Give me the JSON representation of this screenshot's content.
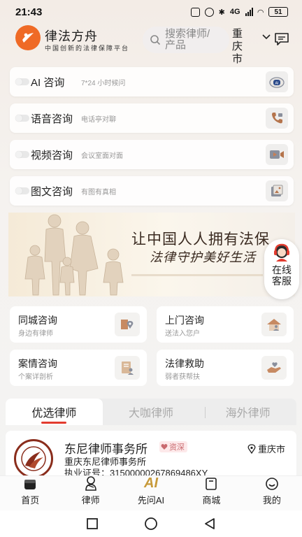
{
  "status_bar": {
    "time": "21:43",
    "network": "4G",
    "battery": "51"
  },
  "header": {
    "app_name": "律法方舟",
    "slogan": "中国创新的法律保障平台",
    "search_placeholder": "搜索律师/产品",
    "city": "重庆市"
  },
  "consult_items": [
    {
      "title": "AI 咨询",
      "subtitle": "7*24 小时候问",
      "icon": "ai-headset-icon"
    },
    {
      "title": "语音咨询",
      "subtitle": "电话亭对聊",
      "icon": "phone-icon"
    },
    {
      "title": "视频咨询",
      "subtitle": "会议室面对面",
      "icon": "video-icon"
    },
    {
      "title": "图文咨询",
      "subtitle": "有图有真相",
      "icon": "image-text-icon"
    }
  ],
  "banner": {
    "line1": "让中国人人拥有法保",
    "line2": "法律守护美好生活"
  },
  "customer_service": {
    "label": "在线客服"
  },
  "service_cards": [
    {
      "title": "同城咨询",
      "subtitle": "身边有律师",
      "icon": "map-pin-icon"
    },
    {
      "title": "上门咨询",
      "subtitle": "送法入您户",
      "icon": "house-icon"
    },
    {
      "title": "案情咨询",
      "subtitle": "个案详剖析",
      "icon": "document-icon"
    },
    {
      "title": "法律救助",
      "subtitle": "弱者获帮扶",
      "icon": "helping-hand-icon"
    }
  ],
  "lawyer_tabs": [
    "优选律师",
    "大咖律师",
    "海外律师"
  ],
  "firm": {
    "name": "东尼律师事务所",
    "tag": "资深",
    "city": "重庆市",
    "full_name": "重庆东尼律师事务所",
    "license": "执业证号：31500000267869486XY"
  },
  "bottom_nav": [
    {
      "label": "首页",
      "icon": "home-icon"
    },
    {
      "label": "律师",
      "icon": "lawyer-icon"
    },
    {
      "label": "先问AI",
      "icon": "ai-icon",
      "icon_text": "AI"
    },
    {
      "label": "商城",
      "icon": "shop-icon"
    },
    {
      "label": "我的",
      "icon": "profile-icon"
    }
  ],
  "colors": {
    "accent": "#ef6a26",
    "tab_indicator": "#e23b2e",
    "ai_gold": "#c79a3a"
  }
}
